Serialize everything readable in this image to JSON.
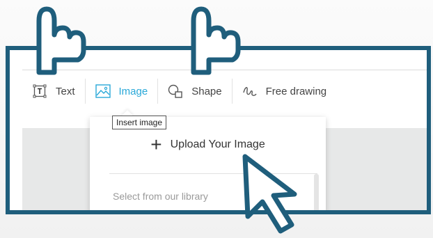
{
  "toolbar": {
    "items": [
      {
        "label": "Text",
        "icon": "text-icon",
        "active": false
      },
      {
        "label": "Image",
        "icon": "image-icon",
        "active": true
      },
      {
        "label": "Shape",
        "icon": "shape-icon",
        "active": false
      },
      {
        "label": "Free drawing",
        "icon": "free-drawing-icon",
        "active": false
      }
    ]
  },
  "dropdown": {
    "upload_label": "Upload Your Image",
    "library_label": "Select from our library"
  },
  "tooltip": {
    "text": "Insert image"
  },
  "colors": {
    "frame_border": "#1f5e7c",
    "active": "#29a8d8",
    "canvas": "#e7e8e8"
  },
  "icons": [
    "pointing-hand-icon",
    "arrow-cursor-icon",
    "plus-icon"
  ]
}
